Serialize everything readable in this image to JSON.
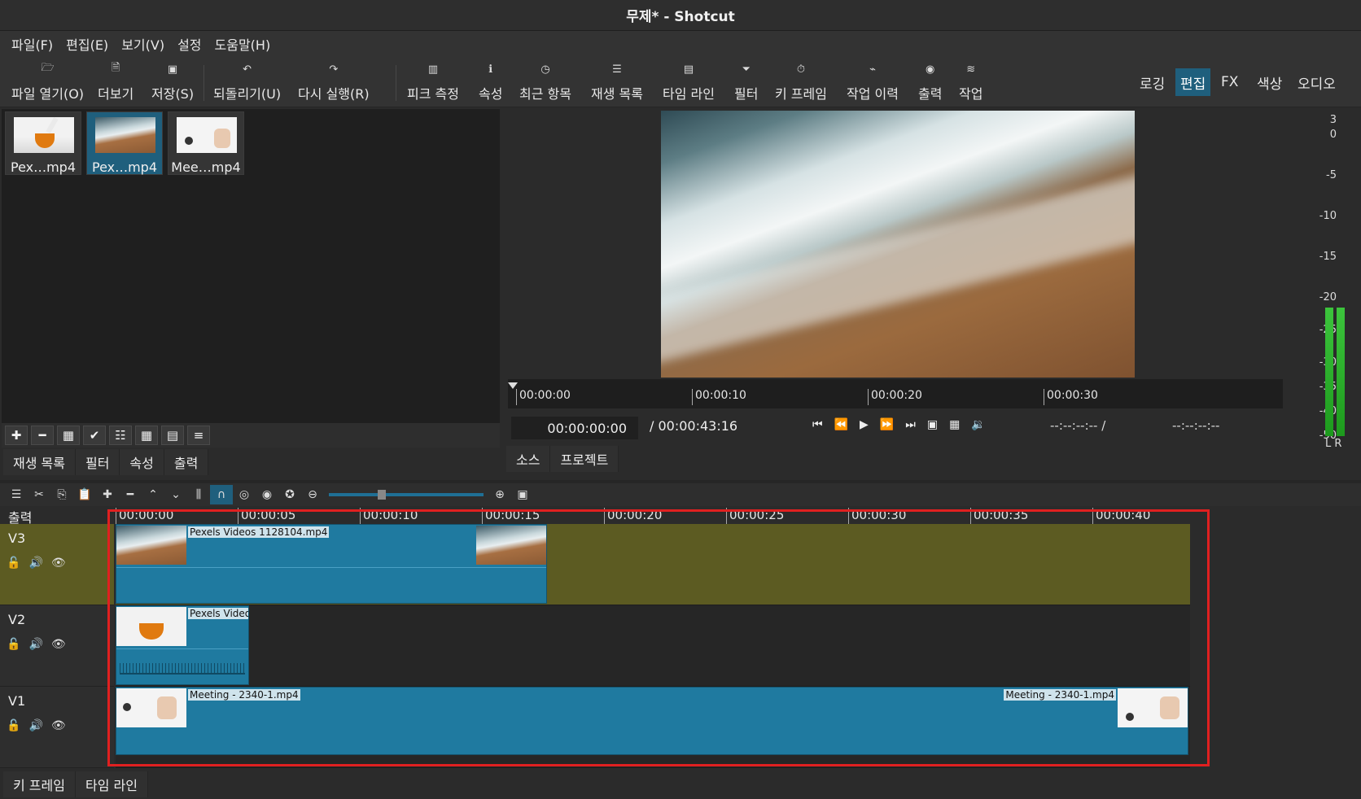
{
  "window": {
    "title": "무제* - Shotcut"
  },
  "menu": [
    "파일(F)",
    "편집(E)",
    "보기(V)",
    "설정",
    "도움말(H)"
  ],
  "toolbar": {
    "open": "파일 열기(O)",
    "more": "더보기",
    "save": "저장(S)",
    "undo": "되돌리기(U)",
    "redo": "다시 실행(R)",
    "peak": "피크 측정",
    "props": "속성",
    "recent": "최근 항목",
    "playlist": "재생 목록",
    "timeline": "타임 라인",
    "filters": "필터",
    "keyframes": "키 프레임",
    "history": "작업 이력",
    "export": "출력",
    "jobs": "작업"
  },
  "workspaces": {
    "logging": "로깅",
    "editing": "편집",
    "fx": "FX",
    "color": "색상",
    "audio": "오디오"
  },
  "playlist": {
    "items": [
      "Pex…mp4",
      "Pex…mp4",
      "Mee…mp4"
    ],
    "selected_index": 1
  },
  "left_tabs": [
    "재생 목록",
    "필터",
    "속성",
    "출력"
  ],
  "viewer": {
    "ruler": [
      "00:00:00",
      "00:00:10",
      "00:00:20",
      "00:00:30"
    ],
    "position": "00:00:00:00",
    "duration": "/ 00:00:43:16",
    "in_point": "--:--:--:-- /",
    "out_point": "--:--:--:--"
  },
  "viewer_tabs": [
    "소스",
    "프로젝트"
  ],
  "meter": {
    "labels": [
      "3",
      "0",
      "-5",
      "-10",
      "-15",
      "-20",
      "-25",
      "-30",
      "-35",
      "-40",
      "-50"
    ],
    "channels": "L R"
  },
  "timeline": {
    "output_label": "출력",
    "ruler": [
      "00:00:00",
      "00:00:05",
      "00:00:10",
      "00:00:15",
      "00:00:20",
      "00:00:25",
      "00:00:30",
      "00:00:35",
      "00:00:40"
    ],
    "tracks": [
      {
        "name": "V3",
        "clips": [
          "Pexels Videos 1128104.mp4"
        ]
      },
      {
        "name": "V2",
        "clips": [
          "Pexels Videos"
        ]
      },
      {
        "name": "V1",
        "clips": [
          "Meeting - 2340-1.mp4",
          "Meeting - 2340-1.mp4"
        ]
      }
    ]
  },
  "bottom_tabs": [
    "키 프레임",
    "타임 라인"
  ],
  "colors": {
    "accent": "#1f5f7d",
    "clip": "#1f7aa0",
    "selected_track": "#5c5b22",
    "highlight": "#e02020"
  }
}
